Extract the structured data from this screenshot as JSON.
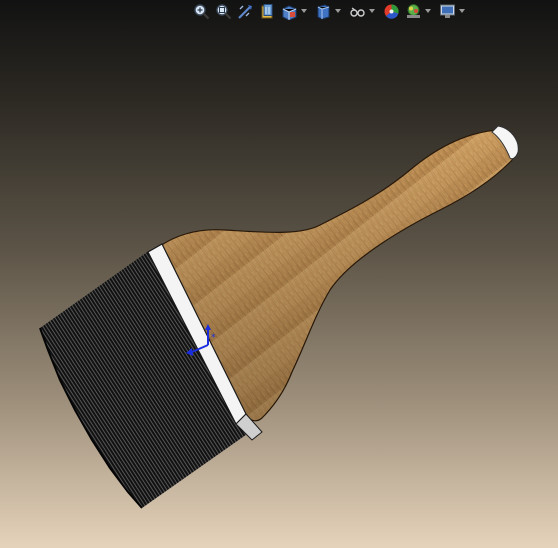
{
  "toolbar": {
    "buttons": [
      {
        "name": "zoom-to-fit-icon",
        "has_dropdown": false
      },
      {
        "name": "zoom-to-area-icon",
        "has_dropdown": false
      },
      {
        "name": "previous-view-icon",
        "has_dropdown": false
      },
      {
        "name": "section-view-icon",
        "has_dropdown": false
      },
      {
        "name": "view-orientation-icon",
        "has_dropdown": true
      },
      {
        "name": "display-style-icon",
        "has_dropdown": true
      },
      {
        "name": "hide-show-items-icon",
        "has_dropdown": true
      },
      {
        "name": "edit-appearance-icon",
        "has_dropdown": false
      },
      {
        "name": "apply-scene-icon",
        "has_dropdown": true
      },
      {
        "name": "view-settings-icon",
        "has_dropdown": true
      }
    ]
  },
  "colors": {
    "wood": "#c79a5c",
    "wood_dark": "#8a6232",
    "ferrule": "#f4f4f4",
    "bristles": "#1b1b1b",
    "triad_blue": "#1a2ee0"
  }
}
